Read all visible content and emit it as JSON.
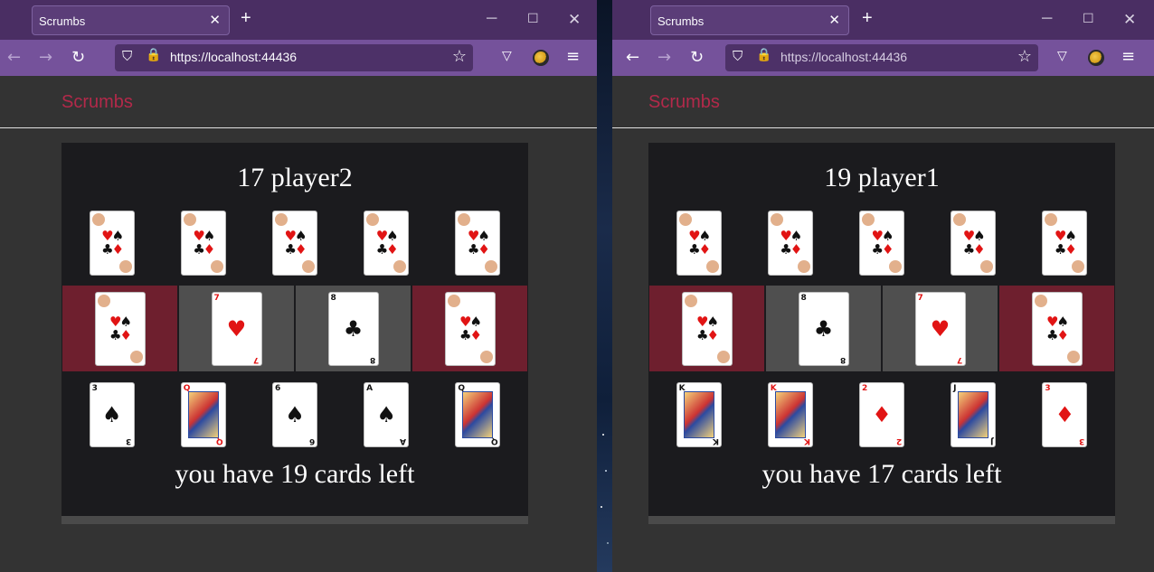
{
  "windows": {
    "left": {
      "tab_title": "Scrumbs",
      "url": "https://localhost:44436",
      "brand": "Scrumbs",
      "score_line": "17 player2",
      "cards_left": "you have 19 cards left",
      "mid_faces": [
        {
          "rank": "7",
          "suit": "♥",
          "color": "red"
        },
        {
          "rank": "8",
          "suit": "♣",
          "color": "black"
        }
      ],
      "hand": [
        {
          "rank": "3",
          "suit": "♠",
          "color": "black",
          "court": false
        },
        {
          "rank": "Q",
          "suit": "♦",
          "color": "red",
          "court": true
        },
        {
          "rank": "6",
          "suit": "♠",
          "color": "black",
          "court": false
        },
        {
          "rank": "A",
          "suit": "♠",
          "color": "black",
          "court": false
        },
        {
          "rank": "Q",
          "suit": "♣",
          "color": "black",
          "court": true
        }
      ]
    },
    "right": {
      "tab_title": "Scrumbs",
      "url": "https://localhost:44436",
      "brand": "Scrumbs",
      "score_line": "19 player1",
      "cards_left": "you have 17 cards left",
      "mid_faces": [
        {
          "rank": "8",
          "suit": "♣",
          "color": "black"
        },
        {
          "rank": "7",
          "suit": "♥",
          "color": "red"
        }
      ],
      "hand": [
        {
          "rank": "K",
          "suit": "♣",
          "color": "black",
          "court": true
        },
        {
          "rank": "K",
          "suit": "♥",
          "color": "red",
          "court": true
        },
        {
          "rank": "2",
          "suit": "♦",
          "color": "red",
          "court": false
        },
        {
          "rank": "J",
          "suit": "♣",
          "color": "black",
          "court": true
        },
        {
          "rank": "3",
          "suit": "♦",
          "color": "red",
          "court": false
        }
      ]
    }
  },
  "icons": {
    "back": "←",
    "forward": "→",
    "reload": "↻",
    "shield": "⛉",
    "lock": "🔒",
    "star": "☆",
    "pocket": "▽",
    "menu": "≡",
    "close_tab": "✕",
    "new_tab": "+",
    "minimize": "─",
    "maximize": "☐",
    "close_window": "✕"
  },
  "colors": {
    "brand": "#b3294a",
    "tab_bar": "#4a2e63",
    "nav_bar": "#75529b",
    "board": "#1b1b1e",
    "back_slot": "#6e1f2e",
    "face_slot": "#4f4f4f"
  }
}
